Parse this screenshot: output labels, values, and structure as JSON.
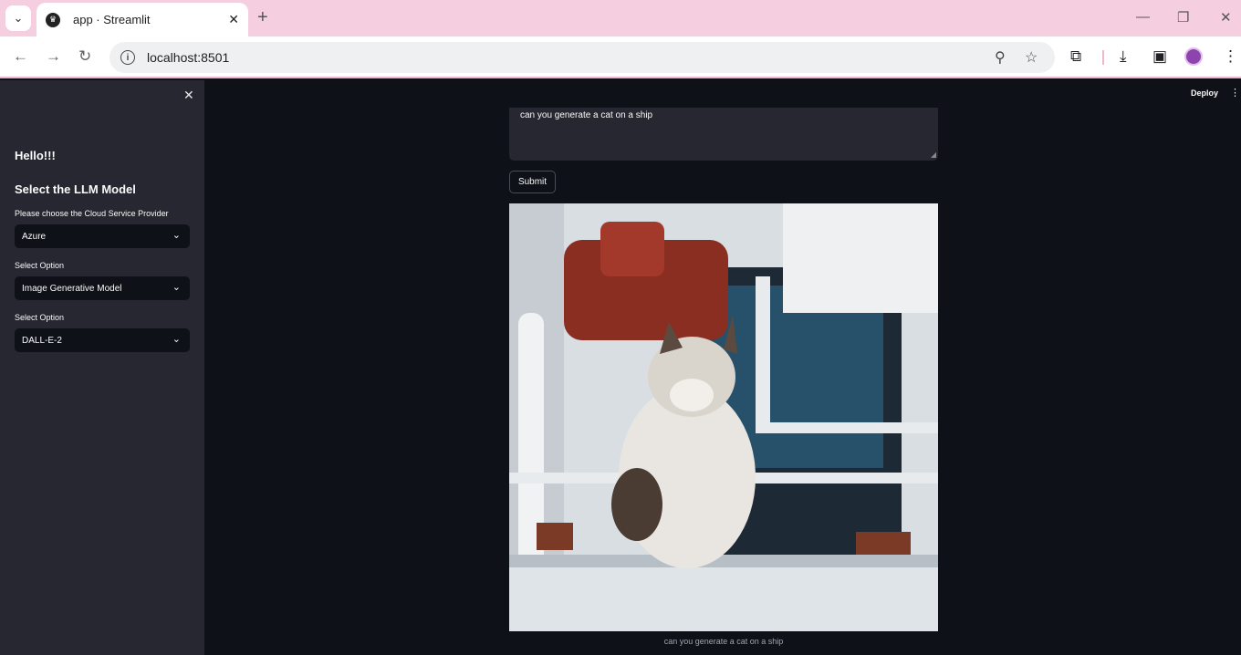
{
  "browser": {
    "tab_title": "app · Streamlit",
    "url": "localhost:8501"
  },
  "sidebar": {
    "greeting": "Hello!!!",
    "section_title": "Select the LLM Model",
    "fields": [
      {
        "label": "Please choose the Cloud Service Provider",
        "value": "Azure"
      },
      {
        "label": "Select Option",
        "value": "Image Generative Model"
      },
      {
        "label": "Select Option",
        "value": "DALL-E-2"
      }
    ]
  },
  "header": {
    "deploy_label": "Deploy"
  },
  "main": {
    "prompt_value": "can you generate a cat on a ship",
    "submit_label": "Submit",
    "image_caption": "can you generate a cat on a ship"
  }
}
